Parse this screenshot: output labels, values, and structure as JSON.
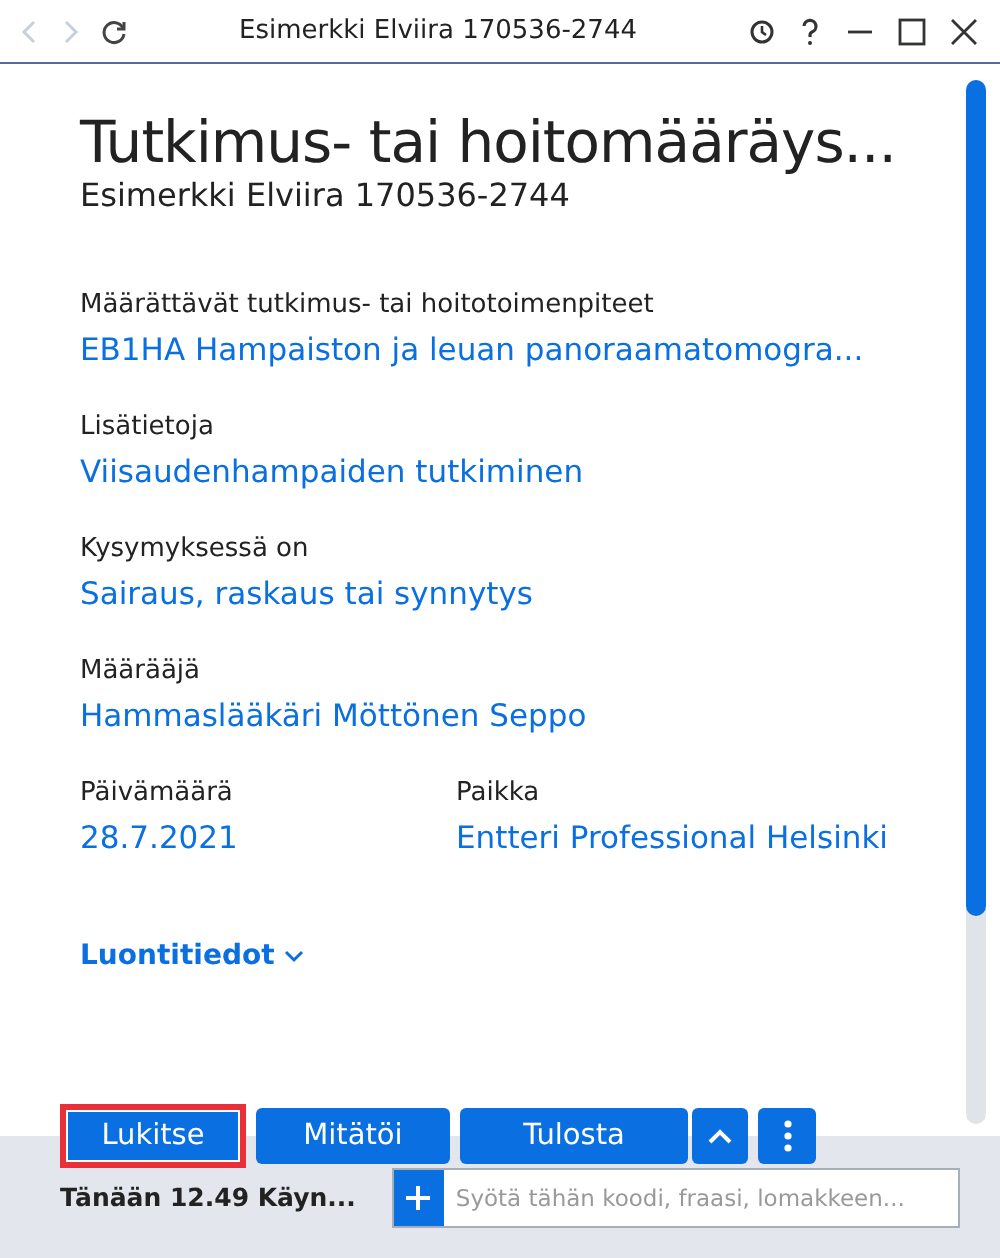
{
  "window": {
    "title": "Esimerkki Elviira 170536-2744"
  },
  "heading": {
    "title": "Tutkimus- tai hoitomääräys...",
    "subtitle": "Esimerkki Elviira 170536-2744"
  },
  "fields": [
    {
      "label": "Määrättävät tutkimus- tai hoitotoimenpiteet",
      "value": "EB1HA Hampaiston ja leuan panoraamatomogra..."
    },
    {
      "label": "Lisätietoja",
      "value": "Viisaudenhampaiden tutkiminen"
    },
    {
      "label": "Kysymyksessä on",
      "value": "Sairaus, raskaus tai synnytys"
    },
    {
      "label": "Määrääjä",
      "value": "Hammaslääkäri Möttönen Seppo"
    }
  ],
  "field_pairs": [
    {
      "label": "Päivämäärä",
      "value": "28.7.2021"
    },
    {
      "label": "Paikka",
      "value": "Entteri Professional Helsinki"
    }
  ],
  "expander": {
    "label": "Luontitiedot",
    "expanded": false
  },
  "actions": [
    {
      "label": "Lukitse",
      "highlighted": true
    },
    {
      "label": "Mitätöi",
      "highlighted": false
    },
    {
      "label": "Tulosta",
      "highlighted": false
    }
  ],
  "status": {
    "text": "Tänään 12.49 Käyn...",
    "placeholder": "Syötä tähän koodi, fraasi, lomakkeen..."
  }
}
